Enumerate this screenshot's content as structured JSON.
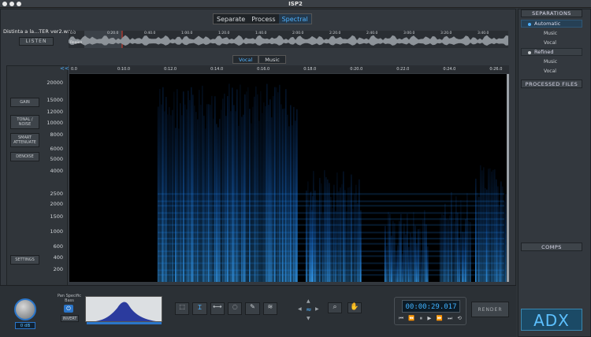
{
  "window": {
    "title": "ISP2"
  },
  "top_tabs": [
    {
      "label": "Separate",
      "active": false
    },
    {
      "label": "Process",
      "active": false
    },
    {
      "label": "Spectral",
      "active": true
    }
  ],
  "transport": {
    "file_name": "Distinta a la...TER ver2.wav",
    "listen_label": "LISTEN",
    "timeline_labels": [
      "0.0",
      "0:20.0",
      "0:40.0",
      "1:00.0",
      "1:20.0",
      "1:40.0",
      "2:00.0",
      "2:20.0",
      "2:40.0",
      "3:00.0",
      "3:20.0",
      "3:40.0"
    ],
    "region_label": "Region"
  },
  "view_tabs": [
    {
      "label": "Vocal",
      "active": true
    },
    {
      "label": "Music",
      "active": false
    }
  ],
  "side_tools": {
    "gain": "GAIN",
    "tonal_noise": "TONAL / NOISE",
    "smart_attenuate": "SMART ATTENUATE",
    "denoise": "DENOISE",
    "settings": "SETTINGS"
  },
  "spectrogram": {
    "nav_arrows": "<<",
    "time_ticks": [
      "0.0",
      "0:10.0",
      "0:12.0",
      "0:14.0",
      "0:16.0",
      "0:18.0",
      "0:20.0",
      "0:22.0",
      "0:24.0",
      "0:26.0"
    ],
    "freq_ticks": [
      "20000",
      "15000",
      "12000",
      "10000",
      "8000",
      "6000",
      "5000",
      "4000",
      "2500",
      "2000",
      "1500",
      "1000",
      "600",
      "400",
      "200"
    ],
    "accent_color": "#1f8fff"
  },
  "right_panel": {
    "separations_title": "SEPARATIONS",
    "automatic": "Automatic",
    "automatic_items": [
      "Music",
      "Vocal"
    ],
    "refined": "Refined",
    "refined_items": [
      "Music",
      "Vocal"
    ],
    "processed_files": "PROCESSED FILES",
    "comps": "COMPS"
  },
  "bottom": {
    "knob_value": "0 dB",
    "pan_label": "Pan Specific",
    "pan_sub": "Bass",
    "invert": "INVERT",
    "time_display": "00:00:29.017",
    "render": "RENDER",
    "logo": "ADX"
  }
}
